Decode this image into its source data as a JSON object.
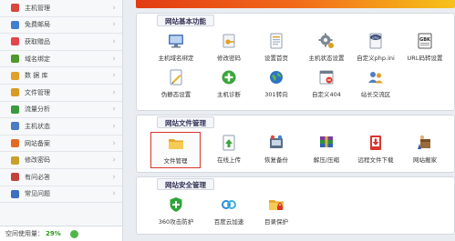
{
  "banner": {
    "text": ""
  },
  "sidebar": {
    "items": [
      {
        "label": "主机管理",
        "color": "#d9463b"
      },
      {
        "label": "免费邮局",
        "color": "#3f7fd1"
      },
      {
        "label": "获取赠品",
        "color": "#e5444b"
      },
      {
        "label": "域名绑定",
        "color": "#4e9a2a"
      },
      {
        "label": "数 据 库",
        "color": "#e0a12a"
      },
      {
        "label": "文件管理",
        "color": "#d89b25"
      },
      {
        "label": "流量分析",
        "color": "#3a9a3d"
      },
      {
        "label": "主机状态",
        "color": "#4b7bc2"
      },
      {
        "label": "网站备案",
        "color": "#e46a24"
      },
      {
        "label": "修改密码",
        "color": "#c8a12b"
      },
      {
        "label": "有问必答",
        "color": "#c2413b"
      },
      {
        "label": "常见问题",
        "color": "#3c6fc0"
      }
    ],
    "quota_label": "空间使用量：",
    "quota_value": "29%"
  },
  "panels": [
    {
      "title": "网站基本功能",
      "tools": [
        {
          "label": "主机域名绑定",
          "icon": "monitor-icon"
        },
        {
          "label": "修改密码",
          "icon": "key-icon"
        },
        {
          "label": "设置首页",
          "icon": "document-icon"
        },
        {
          "label": "主机状态设置",
          "icon": "gear-icon"
        },
        {
          "label": "自定义php.ini",
          "icon": "php-file-icon"
        },
        {
          "label": "URL码转设置",
          "icon": "gbk-icon"
        },
        {
          "label": "伪静态设置",
          "icon": "pencil-doc-icon"
        },
        {
          "label": "主机诊断",
          "icon": "plus-circle-icon"
        },
        {
          "label": "301转向",
          "icon": "globe-icon"
        },
        {
          "label": "自定义404",
          "icon": "error-window-icon"
        },
        {
          "label": "站长交流区",
          "icon": "people-icon"
        }
      ]
    },
    {
      "title": "网站文件管理",
      "tools": [
        {
          "label": "文件管理",
          "icon": "folder-icon"
        },
        {
          "label": "在线上传",
          "icon": "upload-icon"
        },
        {
          "label": "恢复备份",
          "icon": "backup-icon"
        },
        {
          "label": "解压/压缩",
          "icon": "archive-icon"
        },
        {
          "label": "远程文件下载",
          "icon": "download-icon"
        },
        {
          "label": "网站搬家",
          "icon": "move-icon"
        }
      ]
    },
    {
      "title": "网站安全管理",
      "tools": [
        {
          "label": "360攻击防护",
          "icon": "shield-icon"
        },
        {
          "label": "百度云加速",
          "icon": "cloud-icon"
        },
        {
          "label": "目录保护",
          "icon": "folder-lock-icon"
        }
      ]
    }
  ]
}
